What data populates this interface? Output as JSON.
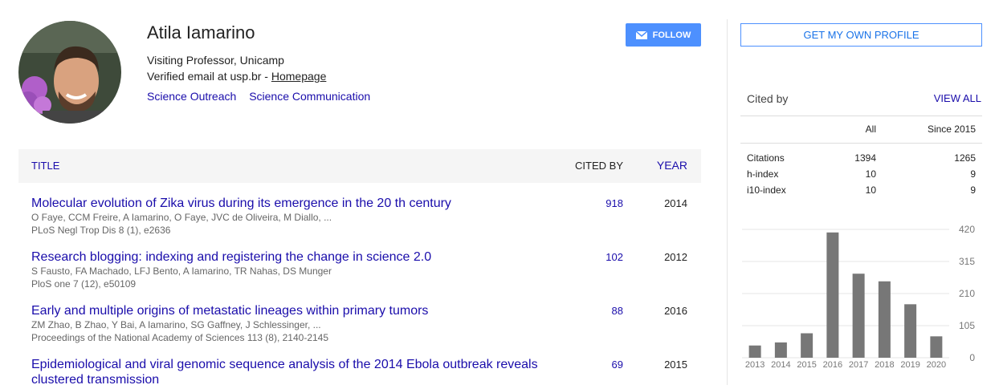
{
  "profile": {
    "name": "Atila Iamarino",
    "affiliation": "Visiting Professor, Unicamp",
    "email_text": "Verified email at usp.br - ",
    "homepage_label": "Homepage",
    "interests": [
      "Science Outreach",
      "Science Communication"
    ],
    "follow_label": "FOLLOW"
  },
  "table": {
    "headers": {
      "title": "TITLE",
      "cited_by": "CITED BY",
      "year": "YEAR"
    },
    "rows": [
      {
        "title": "Molecular evolution of Zika virus during its emergence in the 20 th century",
        "authors": "O Faye, CCM Freire, A Iamarino, O Faye, JVC de Oliveira, M Diallo, ...",
        "venue": "PLoS Negl Trop Dis 8 (1), e2636",
        "cited": "918",
        "year": "2014"
      },
      {
        "title": "Research blogging: indexing and registering the change in science 2.0",
        "authors": "S Fausto, FA Machado, LFJ Bento, A Iamarino, TR Nahas, DS Munger",
        "venue": "PloS one 7 (12), e50109",
        "cited": "102",
        "year": "2012"
      },
      {
        "title": "Early and multiple origins of metastatic lineages within primary tumors",
        "authors": "ZM Zhao, B Zhao, Y Bai, A Iamarino, SG Gaffney, J Schlessinger, ...",
        "venue": "Proceedings of the National Academy of Sciences 113 (8), 2140-2145",
        "cited": "88",
        "year": "2016"
      },
      {
        "title": "Epidemiological and viral genomic sequence analysis of the 2014 Ebola outbreak reveals clustered transmission",
        "authors": "",
        "venue": "",
        "cited": "69",
        "year": "2015"
      }
    ]
  },
  "sidebar": {
    "get_profile_label": "GET MY OWN PROFILE",
    "cited_by_label": "Cited by",
    "view_all_label": "VIEW ALL",
    "col_all": "All",
    "col_since": "Since 2015",
    "stats": [
      {
        "label": "Citations",
        "all": "1394",
        "since": "1265"
      },
      {
        "label": "h-index",
        "all": "10",
        "since": "9"
      },
      {
        "label": "i10-index",
        "all": "10",
        "since": "9"
      }
    ]
  },
  "chart_data": {
    "type": "bar",
    "categories": [
      "2013",
      "2014",
      "2015",
      "2016",
      "2017",
      "2018",
      "2019",
      "2020"
    ],
    "values": [
      40,
      50,
      80,
      410,
      275,
      250,
      175,
      70
    ],
    "yticks": [
      0,
      105,
      210,
      315,
      420
    ],
    "ylim": [
      0,
      420
    ],
    "bar_color": "#777777"
  },
  "colors": {
    "link": "#1a0dab",
    "accent": "#4d90fe"
  }
}
